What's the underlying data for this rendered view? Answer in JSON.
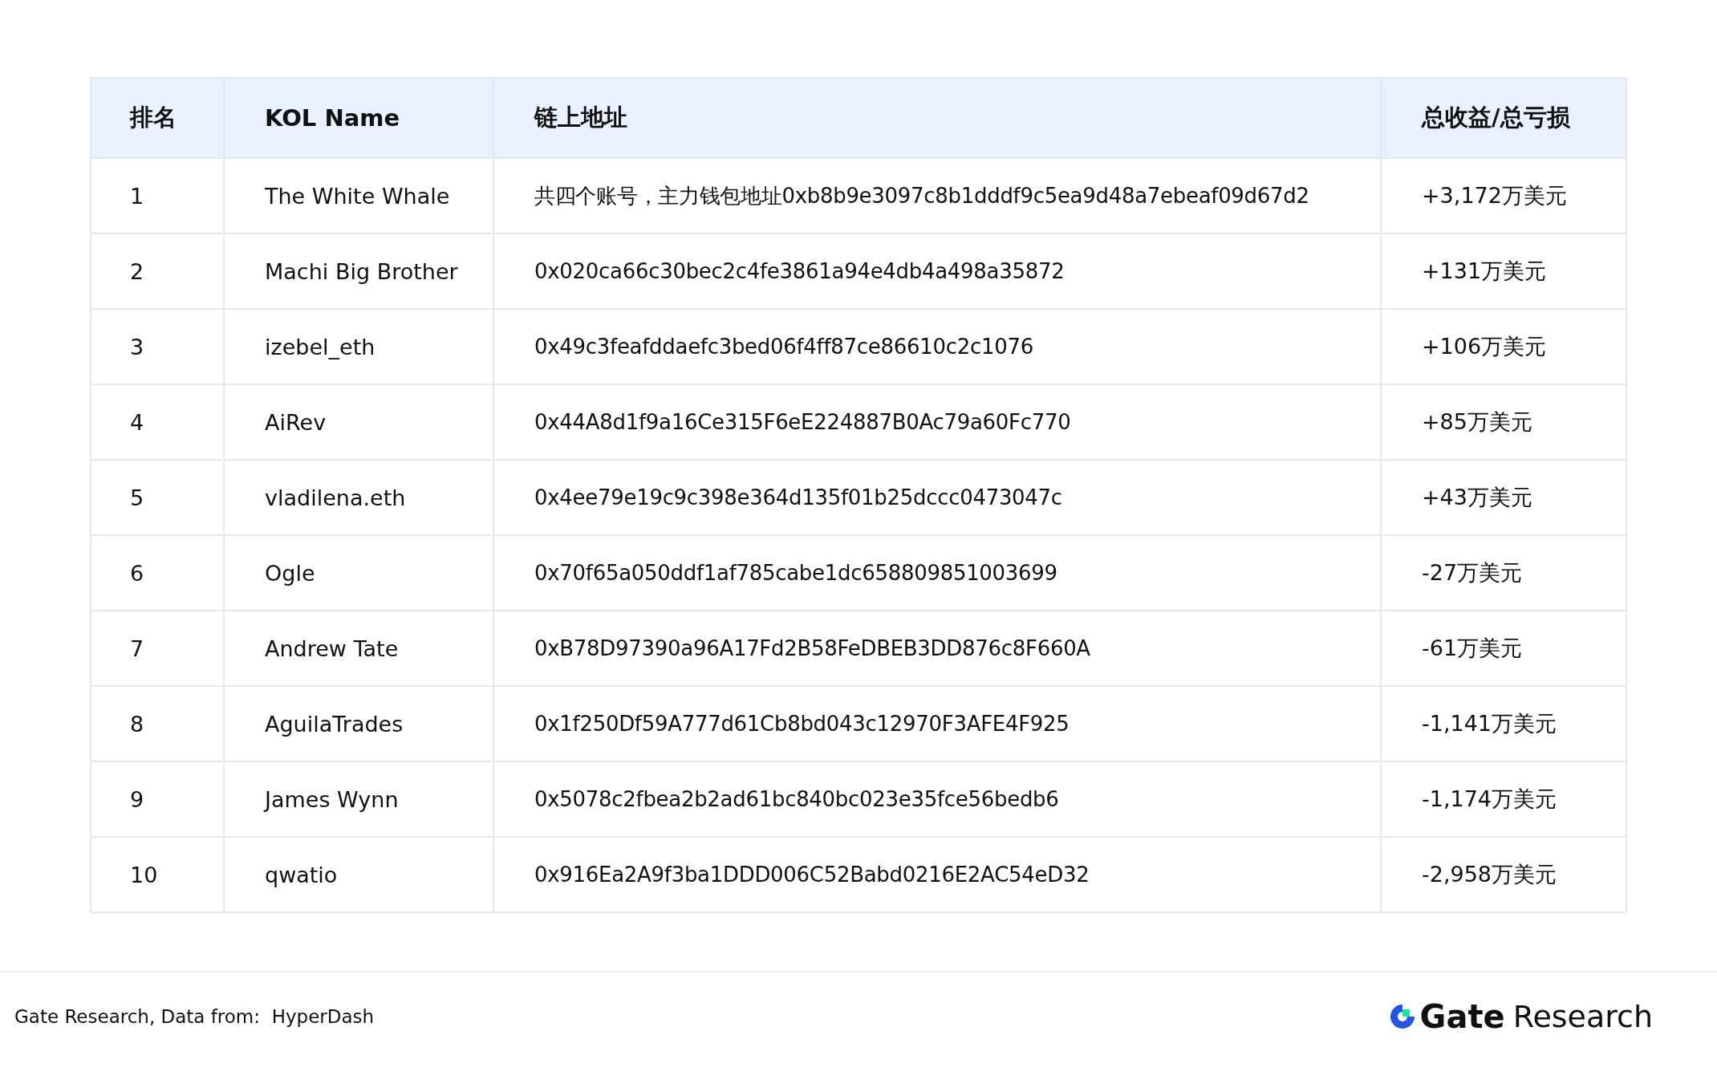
{
  "table": {
    "columns": [
      "排名",
      "KOL Name",
      "链上地址",
      "总收益/总亏损"
    ],
    "rows": [
      {
        "rank": "1",
        "name": "The White Whale",
        "address": "共四个账号，主力钱包地址0xb8b9e3097c8b1dddf9c5ea9d48a7ebeaf09d67d2",
        "pnl": "+3,172万美元"
      },
      {
        "rank": "2",
        "name": "Machi Big Brother",
        "address": "0x020ca66c30bec2c4fe3861a94e4db4a498a35872",
        "pnl": "+131万美元"
      },
      {
        "rank": "3",
        "name": "izebel_eth",
        "address": "0x49c3feafddaefc3bed06f4ff87ce86610c2c1076",
        "pnl": "+106万美元"
      },
      {
        "rank": "4",
        "name": "AiRev",
        "address": "0x44A8d1f9a16Ce315F6eE224887B0Ac79a60Fc770",
        "pnl": "+85万美元"
      },
      {
        "rank": "5",
        "name": "vladilena.eth",
        "address": "0x4ee79e19c9c398e364d135f01b25dccc0473047c",
        "pnl": "+43万美元"
      },
      {
        "rank": "6",
        "name": "Ogle",
        "address": "0x70f65a050ddf1af785cabe1dc658809851003699",
        "pnl": "-27万美元"
      },
      {
        "rank": "7",
        "name": "Andrew Tate",
        "address": "0xB78D97390a96A17Fd2B58FeDBEB3DD876c8F660A",
        "pnl": "-61万美元"
      },
      {
        "rank": "8",
        "name": "AguilaTrades",
        "address": "0x1f250Df59A777d61Cb8bd043c12970F3AFE4F925",
        "pnl": "-1,141万美元"
      },
      {
        "rank": "9",
        "name": "James Wynn",
        "address": "0x5078c2fbea2b2ad61bc840bc023e35fce56bedb6",
        "pnl": "-1,174万美元"
      },
      {
        "rank": "10",
        "name": "qwatio",
        "address": "0x916Ea2A9f3ba1DDD006C52Babd0216E2AC54eD32",
        "pnl": "-2,958万美元"
      }
    ]
  },
  "footer": {
    "source": "Gate Research, Data from:  HyperDash",
    "logo_brand": "Gate",
    "logo_suffix": "Research"
  }
}
